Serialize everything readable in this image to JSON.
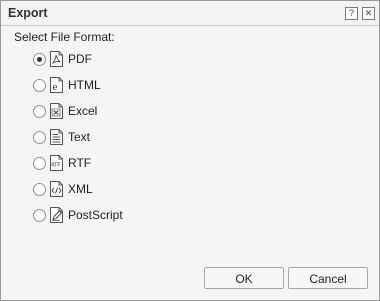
{
  "dialog": {
    "title": "Export",
    "help_label": "?",
    "close_label": "✕",
    "section_label": "Select File Format:",
    "formats": [
      {
        "label": "PDF",
        "icon": "pdf-icon",
        "selected": true
      },
      {
        "label": "HTML",
        "icon": "html-icon",
        "selected": false
      },
      {
        "label": "Excel",
        "icon": "excel-icon",
        "selected": false
      },
      {
        "label": "Text",
        "icon": "text-icon",
        "selected": false
      },
      {
        "label": "RTF",
        "icon": "rtf-icon",
        "selected": false
      },
      {
        "label": "XML",
        "icon": "xml-icon",
        "selected": false
      },
      {
        "label": "PostScript",
        "icon": "postscript-icon",
        "selected": false
      }
    ],
    "ok_label": "OK",
    "cancel_label": "Cancel"
  }
}
